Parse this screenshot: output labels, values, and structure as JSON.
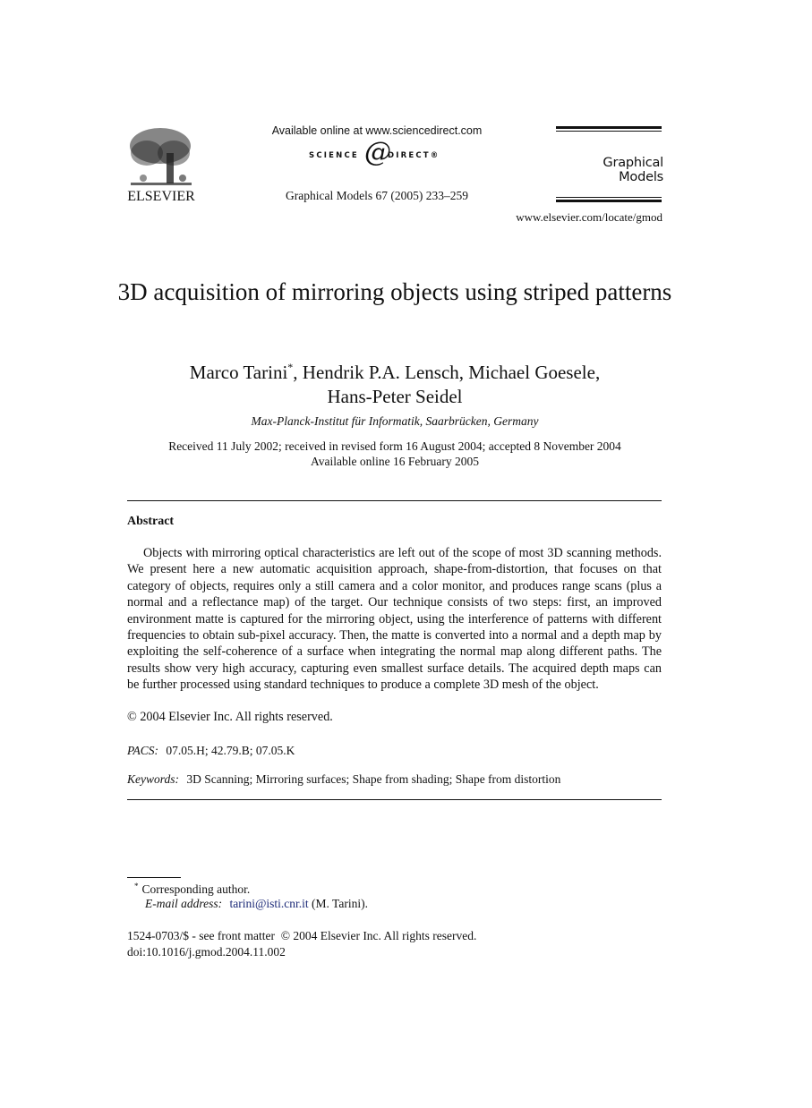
{
  "header": {
    "publisher_logo_text": "ELSEVIER",
    "sciencedirect_available": "Available online at www.sciencedirect.com",
    "sciencedirect_left": "SCIENCE",
    "sciencedirect_at": "@",
    "sciencedirect_right": "DIRECT®",
    "journal_citation": "Graphical Models 67 (2005) 233–259",
    "journal_brand": "Graphical Models",
    "journal_url": "www.elsevier.com/locate/gmod"
  },
  "article": {
    "title": "3D acquisition of mirroring objects using striped patterns",
    "authors_line1_before_mark": "Marco Tarini",
    "author_mark": "*",
    "authors_line1_after_mark": ", Hendrik P.A. Lensch, Michael Goesele,",
    "authors_line2": "Hans-Peter Seidel",
    "affiliation": "Max-Planck-Institut für Informatik, Saarbrücken, Germany",
    "received": "Received 11 July 2002; received in revised form 16 August 2004; accepted 8 November 2004",
    "available_online": "Available online 16 February 2005"
  },
  "abstract": {
    "heading": "Abstract",
    "body": "Objects with mirroring optical characteristics are left out of the scope of most 3D scanning methods. We present here a new automatic acquisition approach, shape-from-distortion, that focuses on that category of objects, requires only a still camera and a color monitor, and produces range scans (plus a normal and a reflectance map) of the target. Our technique consists of two steps: first, an improved environment matte is captured for the mirroring object, using the interference of patterns with different frequencies to obtain sub-pixel accuracy. Then, the matte is converted into a normal and a depth map by exploiting the self-coherence of a surface when integrating the normal map along different paths. The results show very high accuracy, capturing even smallest surface details. The acquired depth maps can be further processed using standard techniques to produce a complete 3D mesh of the object.",
    "copyright": "© 2004 Elsevier Inc. All rights reserved."
  },
  "pacs": {
    "label": "PACS:",
    "value": "07.05.H; 42.79.B; 07.05.K"
  },
  "keywords": {
    "label": "Keywords:",
    "value": "3D Scanning; Mirroring surfaces; Shape from shading; Shape from distortion"
  },
  "footnote": {
    "mark": "*",
    "corresponding": "Corresponding author.",
    "email_label": "E-mail address:",
    "email": "tarini@isti.cnr.it",
    "email_suffix": "(M. Tarini).",
    "link_color": "#1c2a78"
  },
  "footer": {
    "front_matter": "1524-0703/$ - see front matter  © 2004 Elsevier Inc. All rights reserved.",
    "doi": "doi:10.1016/j.gmod.2004.11.002"
  }
}
